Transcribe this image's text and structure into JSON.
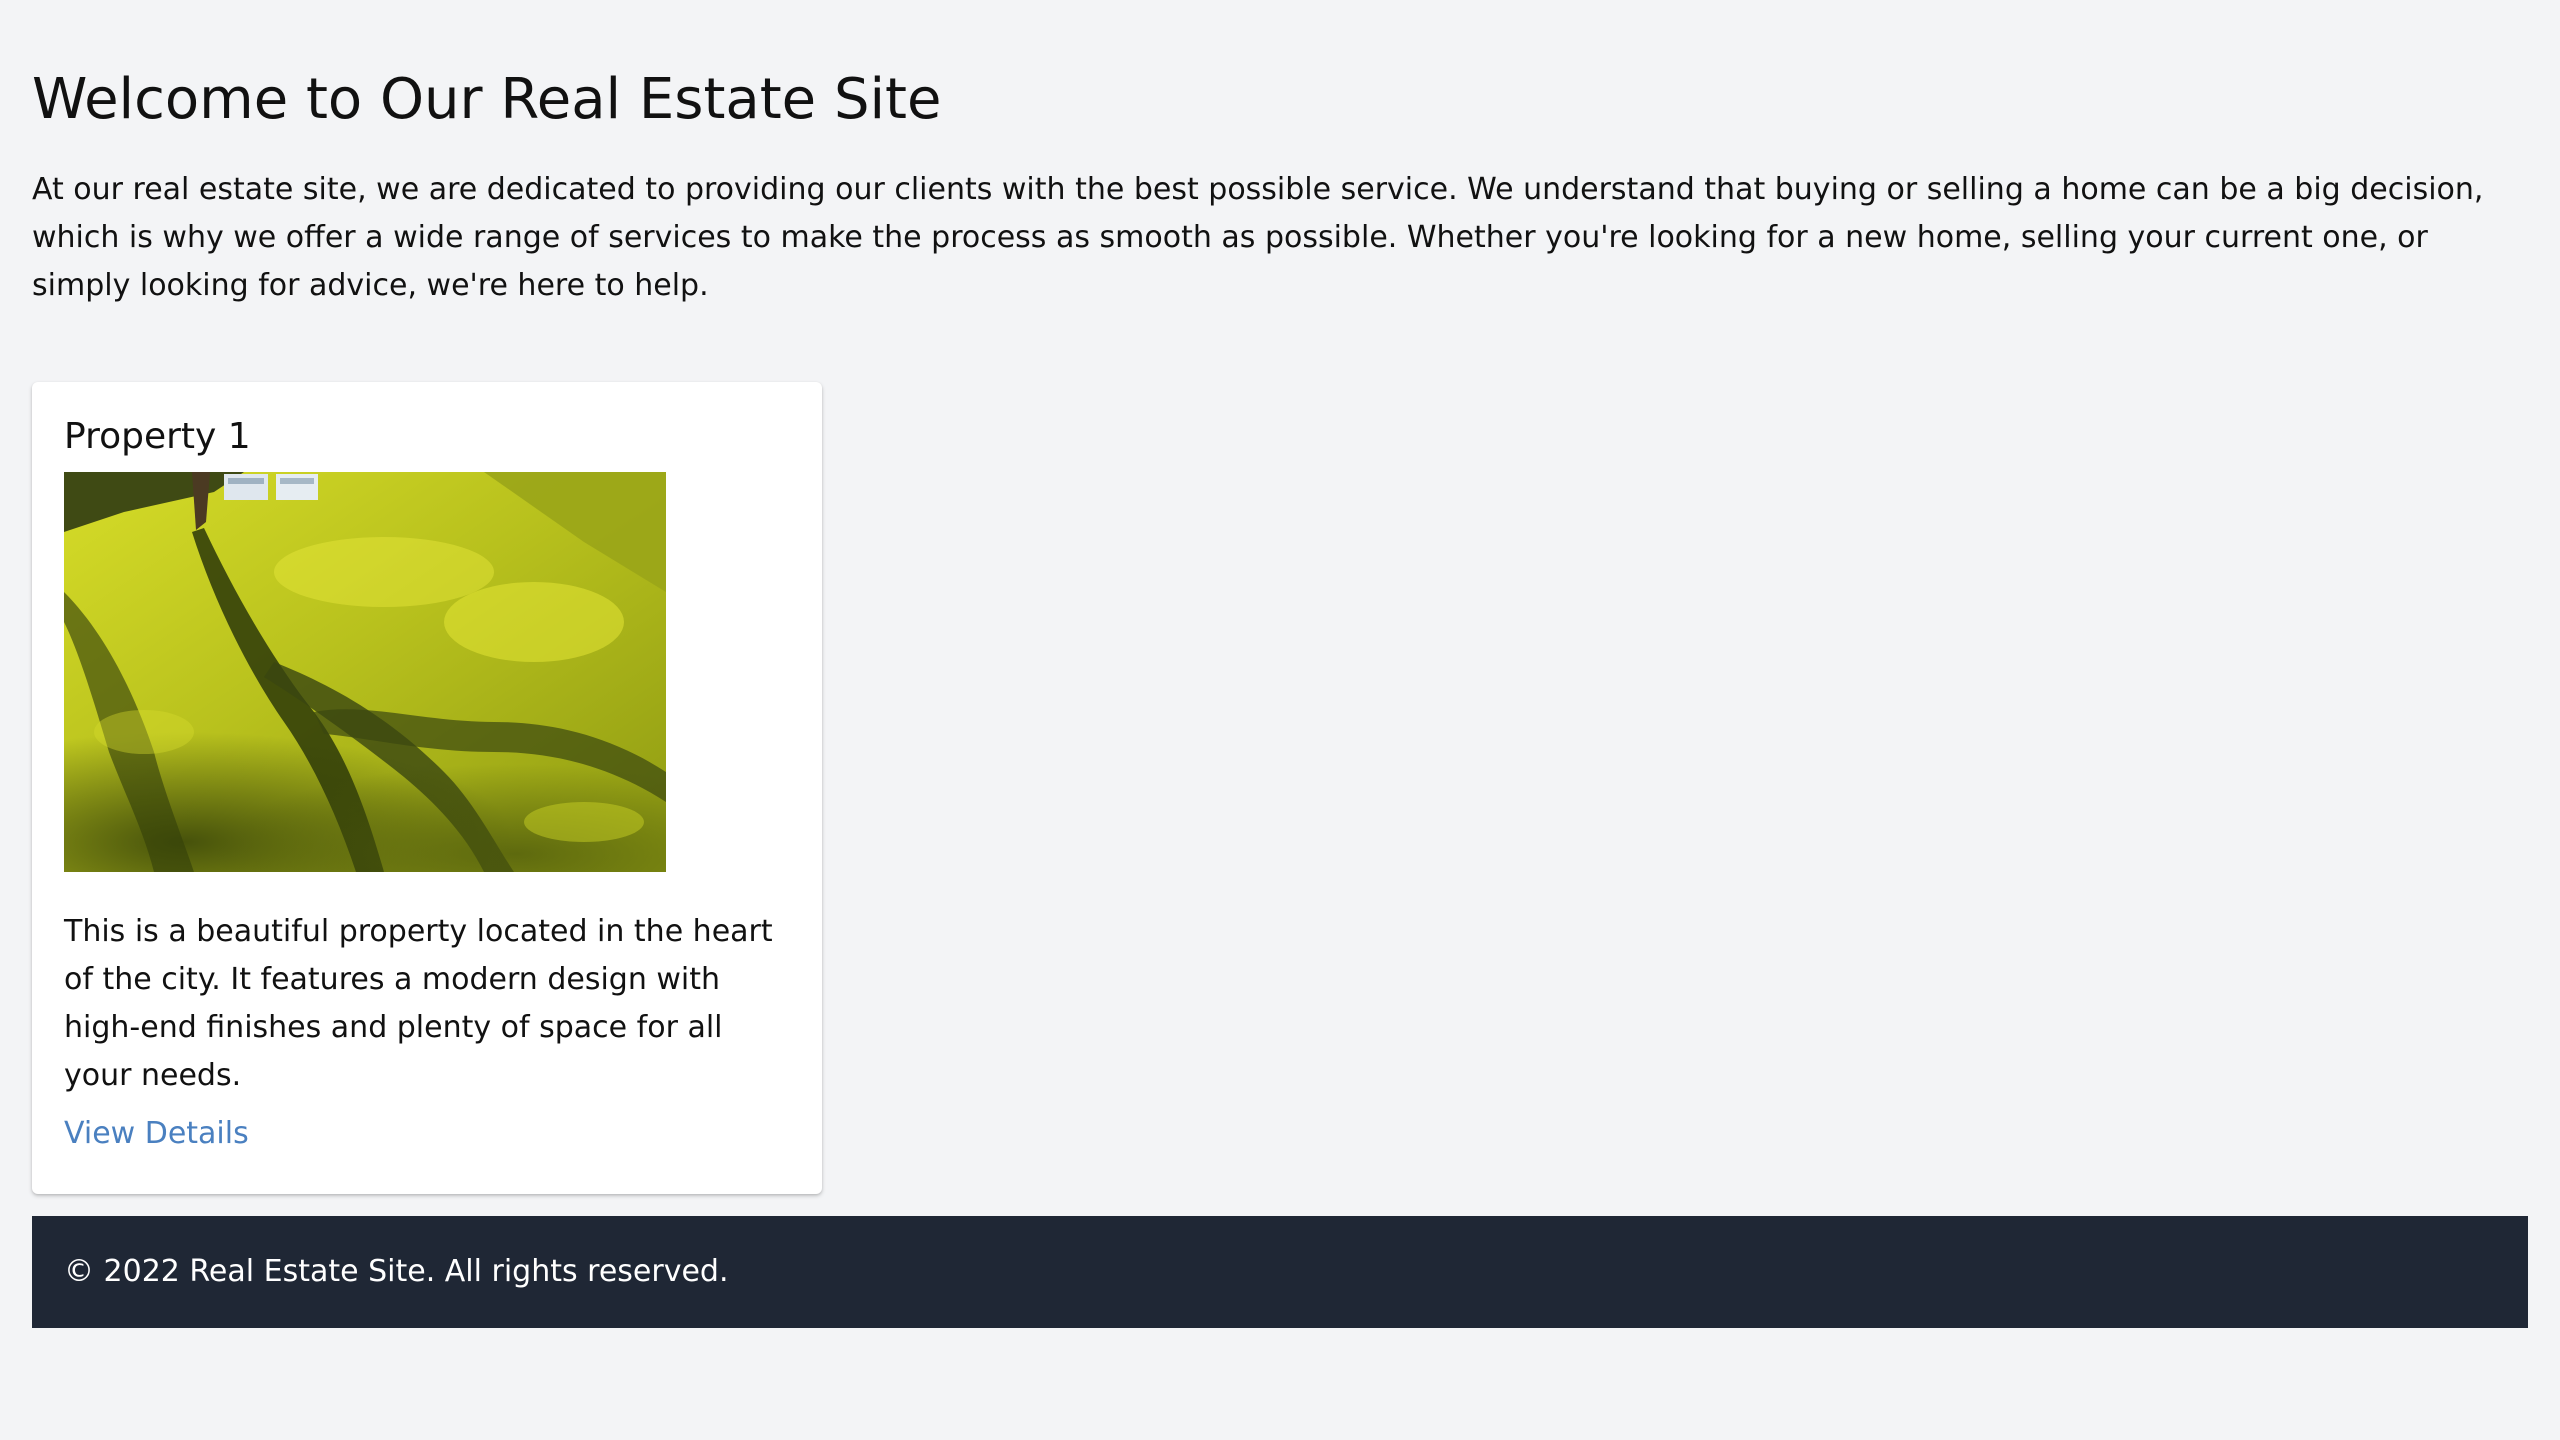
{
  "page": {
    "title": "Welcome to Our Real Estate Site",
    "intro": "At our real estate site, we are dedicated to providing our clients with the best possible service. We understand that buying or selling a home can be a big decision, which is why we offer a wide range of services to make the process as smooth as possible. Whether you're looking for a new home, selling your current one, or simply looking for advice, we're here to help."
  },
  "listings": [
    {
      "title": "Property 1",
      "image_alt": "Sunlit lawn with tree shadows and lounge chairs",
      "description": "This is a beautiful property located in the heart of the city. It features a modern design with high-end finishes and plenty of space for all your needs.",
      "link_label": "View Details"
    }
  ],
  "footer": {
    "text": "© 2022 Real Estate Site. All rights reserved."
  },
  "colors": {
    "background": "#f3f4f6",
    "card": "#ffffff",
    "link": "#4a80c0",
    "footer": "#1f2735"
  }
}
